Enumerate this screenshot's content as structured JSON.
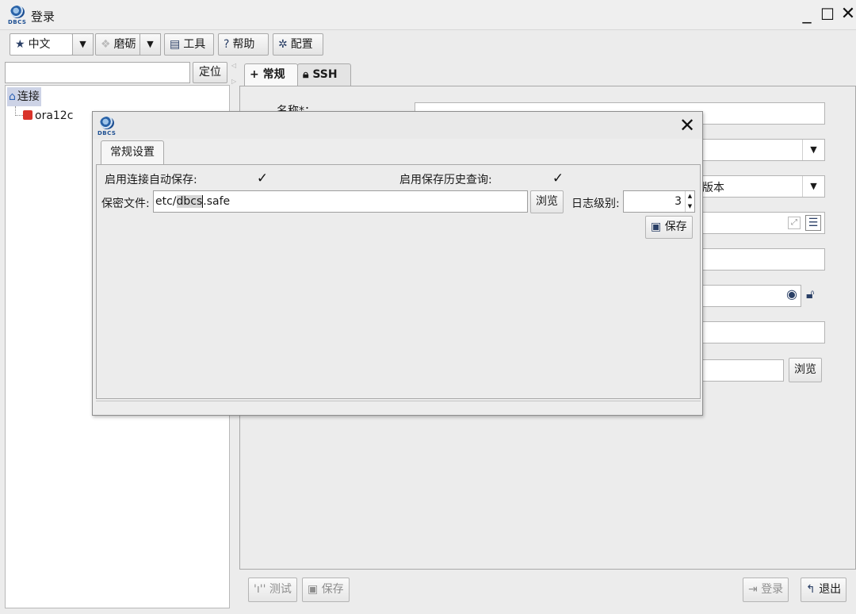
{
  "window": {
    "title": "登录",
    "logo_text": "DBCS"
  },
  "toolbar": {
    "language": "中文",
    "theme": "磨砺",
    "tools": "工具",
    "help": "帮助",
    "config": "配置"
  },
  "sidebar": {
    "search_value": "",
    "locate_button": "定位",
    "tree_root": "连接",
    "tree_child": "ora12c"
  },
  "main": {
    "tabs": [
      {
        "label": "常规",
        "icon": "plus-icon"
      },
      {
        "label": "SSH",
        "icon": "lock-icon"
      }
    ],
    "name_label": "名称*：",
    "version_value": "版本",
    "browse_button": "浏览",
    "test_button": "测试",
    "save_button": "保存",
    "login_button": "登录",
    "exit_button": "退出"
  },
  "dialog": {
    "tab_label": "常规设置",
    "auto_save_label": "启用连接自动保存:",
    "auto_save_checked": true,
    "history_label": "启用保存历史查询:",
    "history_checked": true,
    "secret_file_label": "保密文件:",
    "secret_file_before": "etc/",
    "secret_file_selected": "dbcs",
    "secret_file_after": ".safe",
    "browse_button": "浏览",
    "log_level_label": "日志级别:",
    "log_level_value": "3",
    "save_button": "保存"
  }
}
